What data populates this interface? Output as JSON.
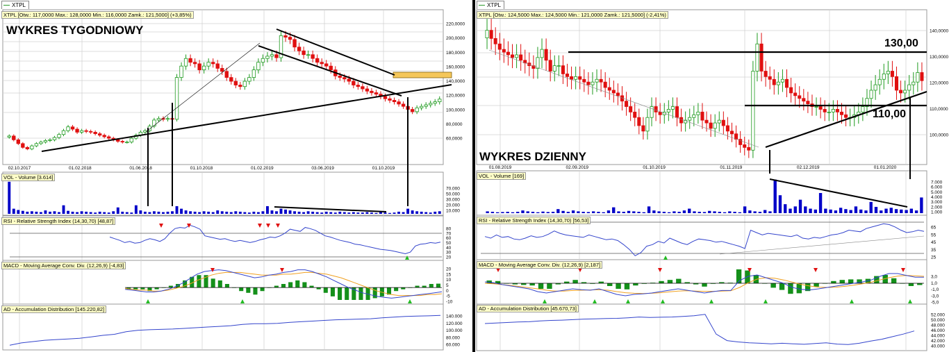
{
  "window": {
    "tab_left": "XTPL",
    "tab_right": "XTPL"
  },
  "left": {
    "price_caption": "XTPL [Otw.: 117,0000  Max.: 128,0000  Min.: 116,0000  Zamk.: 121,5000] (+3,85%)",
    "overlay_title": "WYKRES TYGODNIOWY",
    "vol_caption": "VOL - Volume [3.614]",
    "rsi_caption": "RSI - Relative Strength Index (14,30,70) [48,87]",
    "macd_caption": "MACD - Moving Average Conv. Div. (12,26,9) [-4,83]",
    "ad_caption": "AD - Accumulation Distribution [145.220,82]"
  },
  "right": {
    "price_caption": "XTPL [Otw.: 124,5000  Max.: 124,5000  Min.: 121,0000  Zamk.: 121,5000] (-2,41%)",
    "overlay_title": "WYKRES DZIENNY",
    "level_high": "130,00",
    "level_low": "110,00",
    "vol_caption": "VOL - Volume [169]",
    "rsi_caption": "RSI - Relative Strength Index (14,30,70) [56,53]",
    "macd_caption": "MACD - Moving Average Conv. Div. (12,26,9) [2,187]",
    "ad_caption": "AD - Accumulation Distribution [45.670,73]"
  },
  "colors": {
    "up": "#1e9a1e",
    "down": "#e01010",
    "volume": "#0000c8",
    "indicator": "#3344cc",
    "signal": "#f0a020",
    "highlight": "#f5c75a"
  },
  "chart_data": [
    {
      "type": "candlestick",
      "title": "WYKRES TYGODNIOWY",
      "x_ticks": [
        "02.10.2017",
        "01.02.2018",
        "01.06.2018",
        "01.10.2018",
        "01.02.2019",
        "03.06.2019",
        "01.10.2019"
      ],
      "y_ticks": [
        "220,0000",
        "200,0000",
        "180,0000",
        "160,0000",
        "140,0000",
        "120,0000",
        "100,0000",
        "80,0000",
        "60,0000"
      ],
      "ylim": [
        40,
        230
      ],
      "close": [
        73,
        68,
        63,
        58,
        56,
        60,
        63,
        65,
        67,
        68,
        71,
        75,
        80,
        85,
        82,
        78,
        80,
        79,
        78,
        76,
        74,
        72,
        70,
        68,
        66,
        65,
        65,
        70,
        74,
        78,
        80,
        86,
        94,
        96,
        95,
        96,
        95,
        150,
        165,
        175,
        170,
        168,
        160,
        165,
        170,
        168,
        162,
        158,
        150,
        145,
        140,
        138,
        145,
        150,
        160,
        170,
        175,
        178,
        180,
        176,
        205,
        203,
        200,
        190,
        185,
        180,
        180,
        175,
        170,
        168,
        165,
        160,
        152,
        150,
        148,
        145,
        140,
        138,
        135,
        132,
        130,
        128,
        125,
        122,
        120,
        118,
        115,
        112,
        108,
        105,
        110,
        112,
        114,
        116,
        118,
        121.5
      ]
    },
    {
      "type": "bar",
      "title": "VOL - Volume",
      "y_ticks": [
        "70.000",
        "50.000",
        "30.000",
        "20.000",
        "10.000"
      ],
      "values": [
        75000,
        12000,
        9000,
        7000,
        5000,
        6000,
        5000,
        4000,
        8000,
        5000,
        6000,
        4000,
        20000,
        7000,
        5000,
        4000,
        6000,
        5000,
        4000,
        3000,
        5000,
        4000,
        3000,
        6000,
        15000,
        5000,
        4000,
        3000,
        20000,
        8000,
        5000,
        4000,
        6000,
        5000,
        4000,
        5000,
        6000,
        18000,
        12000,
        8000,
        6000,
        5000,
        4000,
        6000,
        5000,
        4000,
        8000,
        6000,
        5000,
        4000,
        6000,
        5000,
        4000,
        3000,
        5000,
        4000,
        6000,
        18000,
        8000,
        6000,
        12000,
        10000,
        8000,
        6000,
        5000,
        4000,
        6000,
        5000,
        4000,
        3000,
        5000,
        4000,
        3000,
        5000,
        4000,
        3000,
        4000,
        3000,
        3000,
        4000,
        3000,
        2000,
        4000,
        3000,
        2000,
        3000,
        5000,
        4000,
        12000,
        8000,
        6000,
        5000,
        4000,
        3000,
        5000,
        6000
      ]
    },
    {
      "type": "line",
      "title": "RSI - Relative Strength Index (14,30,70)",
      "y_ticks": [
        "80",
        "70",
        "60",
        "50",
        "40",
        "30",
        "20"
      ],
      "values": [
        58,
        55,
        52,
        48,
        50,
        47,
        48,
        52,
        55,
        53,
        50,
        55,
        65,
        73,
        75,
        74,
        79,
        76,
        72,
        60,
        58,
        56,
        54,
        55,
        52,
        50,
        52,
        50,
        48,
        50,
        53,
        55,
        58,
        57,
        60,
        65,
        72,
        70,
        68,
        75,
        73,
        70,
        65,
        60,
        58,
        55,
        52,
        50,
        48,
        45,
        44,
        42,
        40,
        38,
        36,
        35,
        34,
        32,
        30,
        28,
        31,
        42,
        45,
        46,
        48,
        47,
        48.87
      ]
    },
    {
      "type": "line",
      "title": "MACD - Moving Average Conv. Div. (12,26,9)",
      "y_ticks": [
        "20",
        "15",
        "10",
        "5",
        "0",
        "-5",
        "-10"
      ],
      "series": [
        {
          "name": "MACD",
          "values": [
            -2,
            -3,
            -4,
            -5,
            -5,
            -4,
            -2,
            1,
            5,
            10,
            15,
            18,
            19,
            20,
            19,
            17,
            15,
            13,
            11,
            12,
            14,
            15,
            17,
            18,
            20,
            20,
            18,
            15,
            12,
            8,
            4,
            0,
            -3,
            -6,
            -8,
            -10,
            -11,
            -12,
            -11,
            -10,
            -9,
            -8,
            -7,
            -6,
            -4.83
          ]
        },
        {
          "name": "Signal",
          "values": [
            -1,
            -2,
            -3,
            -3,
            -4,
            -4,
            -3,
            -1,
            1,
            4,
            8,
            11,
            14,
            16,
            17,
            17,
            17,
            16,
            15,
            14,
            14,
            14,
            15,
            15,
            16,
            17,
            17,
            16,
            15,
            13,
            11,
            8,
            5,
            2,
            -1,
            -4,
            -6,
            -8,
            -9,
            -9,
            -9,
            -9,
            -8,
            -8,
            -7
          ]
        }
      ]
    },
    {
      "type": "area",
      "title": "AD - Accumulation Distribution",
      "y_ticks": [
        "140.000",
        "120.000",
        "100.000",
        "80.000",
        "60.000"
      ],
      "values": [
        55000,
        62000,
        66000,
        70000,
        72000,
        74000,
        76000,
        80000,
        85000,
        88000,
        96000,
        100000,
        102000,
        103000,
        104000,
        106000,
        108000,
        110000,
        112000,
        114000,
        118000,
        120000,
        120000,
        121000,
        124000,
        126000,
        128000,
        130000,
        132000,
        133000,
        134000,
        135000,
        138000,
        140000,
        142000,
        143000,
        144000,
        145220
      ]
    },
    {
      "type": "candlestick",
      "title": "WYKRES DZIENNY",
      "x_ticks": [
        "01.08.2019",
        "02.09.2019",
        "01.10.2019",
        "01.11.2019",
        "02.12.2019",
        "01.01.2020"
      ],
      "y_ticks": [
        "140,0000",
        "130,0000",
        "120,0000",
        "110,0000",
        "100,0000"
      ],
      "ylim": [
        92,
        145
      ],
      "close": [
        140,
        137,
        135,
        133,
        132,
        131,
        130,
        131,
        129,
        128,
        127,
        126,
        130,
        133,
        129,
        125,
        127,
        127,
        124,
        123,
        122,
        123,
        122,
        121,
        120,
        121,
        122,
        121,
        119,
        118,
        117,
        116,
        114,
        112,
        110,
        108,
        105,
        103,
        108,
        112,
        110,
        109,
        110,
        111,
        112,
        108,
        106,
        107,
        108,
        109,
        110,
        107,
        106,
        104,
        106,
        107,
        105,
        103,
        102,
        100,
        98,
        97,
        96,
        125,
        135,
        125,
        123,
        122,
        120,
        121,
        122,
        119,
        117,
        116,
        115,
        114,
        113,
        112,
        112,
        111,
        110,
        110,
        111,
        110,
        109,
        108,
        108,
        109,
        110,
        112,
        115,
        118,
        120,
        122,
        124,
        125,
        123,
        118,
        117,
        118,
        120,
        121,
        124.5,
        121.5
      ]
    },
    {
      "type": "bar",
      "title": "VOL - Volume",
      "y_ticks": [
        "7.000",
        "6.000",
        "5.000",
        "4.000",
        "3.000",
        "2.000",
        "1.000"
      ],
      "values": [
        400,
        300,
        200,
        250,
        300,
        200,
        300,
        600,
        400,
        300,
        200,
        350,
        250,
        300,
        900,
        500,
        300,
        600,
        400,
        300,
        250,
        400,
        300,
        200,
        600,
        1300,
        400,
        300,
        500,
        400,
        300,
        200,
        1500,
        600,
        400,
        300,
        200,
        400,
        300,
        600,
        1000,
        400,
        300,
        250,
        500,
        400,
        300,
        200,
        400,
        300,
        200,
        1500,
        600,
        400,
        300,
        700,
        400,
        7500,
        4000,
        2000,
        1000,
        1500,
        3000,
        1500,
        1000,
        800,
        4500,
        1000,
        800,
        600,
        1200,
        900,
        700,
        1500,
        800,
        600,
        2500,
        1400,
        600,
        1000,
        1200,
        900,
        800,
        700,
        1000,
        600,
        3500
      ]
    },
    {
      "type": "line",
      "title": "RSI - Relative Strength Index (14,30,70)",
      "y_ticks": [
        "65",
        "55",
        "45",
        "35",
        "25"
      ],
      "values": [
        50,
        48,
        52,
        49,
        50,
        47,
        46,
        48,
        51,
        49,
        50,
        53,
        57,
        54,
        52,
        51,
        50,
        49,
        52,
        50,
        48,
        46,
        47,
        45,
        40,
        34,
        26,
        30,
        38,
        40,
        44,
        42,
        48,
        45,
        42,
        40,
        44,
        47,
        46,
        45,
        43,
        44,
        42,
        40,
        38,
        35,
        58,
        55,
        52,
        54,
        53,
        52,
        51,
        50,
        52,
        48,
        47,
        49,
        48,
        50,
        52,
        53,
        55,
        58,
        57,
        56,
        60,
        62,
        64,
        66,
        65,
        62,
        58,
        55,
        56,
        58,
        56.53
      ]
    },
    {
      "type": "line",
      "title": "MACD - Moving Average Conv. Div. (12,26,9)",
      "y_ticks": [
        "3,0",
        "1,0",
        "-1,0",
        "-3,0",
        "-5,0"
      ],
      "series": [
        {
          "name": "MACD",
          "values": [
            0.5,
            0.2,
            -0.5,
            -1,
            -1.5,
            -2,
            -3,
            -3.5,
            -3,
            -2.5,
            -2,
            -2.3,
            -2.5,
            -2,
            -3,
            -4,
            -4.5,
            -4,
            -3.8,
            -3.5,
            -3,
            -2.5,
            -2,
            -2.5,
            -3,
            -3.5,
            -3,
            -2.6,
            -2.6,
            1.0,
            2.5,
            3.0,
            2.0,
            1.0,
            0,
            -1.5,
            -2.2,
            -2.4,
            -2.0,
            -1.5,
            -1,
            -0.5,
            0,
            0.5,
            1.2,
            2.5,
            3.5,
            3.5,
            2.8,
            2.2,
            2.187
          ]
        },
        {
          "name": "Signal",
          "values": [
            0,
            -0.2,
            -0.5,
            -0.8,
            -1.2,
            -1.6,
            -2,
            -2.5,
            -2.8,
            -2.8,
            -2.6,
            -2.5,
            -2.4,
            -2.3,
            -2.5,
            -3,
            -3.4,
            -3.6,
            -3.7,
            -3.6,
            -3.4,
            -3.1,
            -2.8,
            -2.7,
            -2.8,
            -2.9,
            -2.9,
            -2.8,
            -2.7,
            -1.5,
            0.2,
            1.5,
            2.0,
            1.8,
            1.2,
            0.4,
            -0.4,
            -1.0,
            -1.4,
            -1.5,
            -1.4,
            -1.1,
            -0.7,
            -0.2,
            0.4,
            1.2,
            2.0,
            2.6,
            2.8,
            2.7,
            2.5
          ]
        }
      ]
    },
    {
      "type": "area",
      "title": "AD - Accumulation Distribution",
      "y_ticks": [
        "52.000",
        "50.000",
        "48.000",
        "46.000",
        "44.000",
        "42.000",
        "40.000"
      ],
      "values": [
        48500,
        48700,
        48900,
        49100,
        49200,
        49500,
        49700,
        49800,
        50000,
        50200,
        50300,
        50400,
        50500,
        50700,
        51000,
        50800,
        50900,
        51000,
        51200,
        51500,
        52000,
        44500,
        42000,
        41500,
        41200,
        41000,
        40800,
        41000,
        40800,
        40600,
        40900,
        41200,
        40700,
        40500,
        41000,
        41800,
        42500,
        43500,
        44500,
        45670
      ]
    }
  ]
}
